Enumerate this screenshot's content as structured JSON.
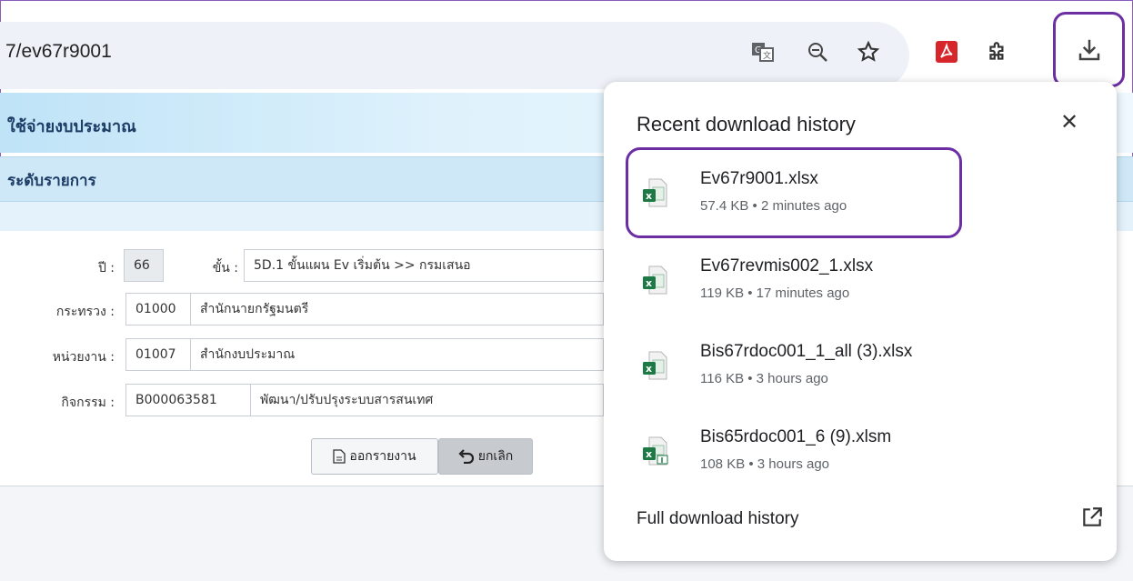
{
  "browser": {
    "url": "7/ev67r9001"
  },
  "app": {
    "header_title": "ใช้จ่ายงบประมาณ",
    "section_title": "ระดับรายการ",
    "form": {
      "year_label": "ปี :",
      "year_value": "66",
      "step_label": "ขั้น :",
      "step_value": "5D.1 ขั้นแผน Ev เริ่มต้น >> กรมเสนอ",
      "ministry_label": "กระทรวง :",
      "ministry_code": "01000",
      "ministry_name": "สำนักนายกรัฐมนตรี",
      "agency_label": "หน่วยงาน :",
      "agency_code": "01007",
      "agency_name": "สำนักงบประมาณ",
      "activity_label": "กิจกรรม :",
      "activity_code": "B000063581",
      "activity_name": "พัฒนา/ปรับปรุงระบบสารสนเทศ"
    },
    "buttons": {
      "report": "ออกรายงาน",
      "cancel": "ยกเลิก"
    }
  },
  "downloads": {
    "title": "Recent download history",
    "items": [
      {
        "name": "Ev67r9001.xlsx",
        "meta": "57.4 KB • 2 minutes ago",
        "icon": "excel-file-icon"
      },
      {
        "name": "Ev67revmis002_1.xlsx",
        "meta": "119 KB • 17 minutes ago",
        "icon": "excel-file-icon"
      },
      {
        "name": "Bis67rdoc001_1_all (3).xlsx",
        "meta": "116 KB • 3 hours ago",
        "icon": "excel-file-icon"
      },
      {
        "name": "Bis65rdoc001_6 (9).xlsm",
        "meta": "108 KB • 3 hours ago",
        "icon": "excel-macro-file-icon"
      }
    ],
    "full_history": "Full download history"
  },
  "colors": {
    "highlight": "#6b2fa3",
    "header_blue": "#cfe8f7",
    "excel_green": "#1d7a45"
  }
}
